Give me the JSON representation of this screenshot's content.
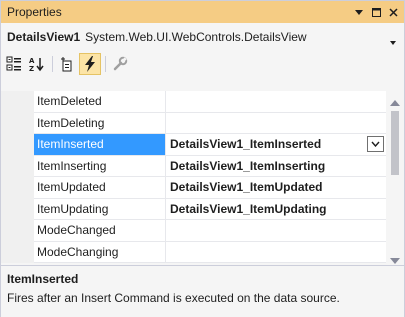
{
  "window": {
    "title": "Properties"
  },
  "object_selector": {
    "name": "DetailsView1",
    "type": "System.Web.UI.WebControls.DetailsView"
  },
  "toolbar": {
    "buttons": [
      {
        "icon": "categorized-icon",
        "active": false
      },
      {
        "icon": "alphabetical-icon",
        "active": false
      },
      {
        "icon": "properties-icon",
        "active": false
      },
      {
        "icon": "events-lightning-icon",
        "active": true
      },
      {
        "icon": "property-pages-wrench-icon",
        "active": false
      }
    ]
  },
  "events": {
    "rows": [
      {
        "name": "ItemDeleted",
        "value": ""
      },
      {
        "name": "ItemDeleting",
        "value": ""
      },
      {
        "name": "ItemInserted",
        "value": "DetailsView1_ItemInserted"
      },
      {
        "name": "ItemInserting",
        "value": "DetailsView1_ItemInserting"
      },
      {
        "name": "ItemUpdated",
        "value": "DetailsView1_ItemUpdated"
      },
      {
        "name": "ItemUpdating",
        "value": "DetailsView1_ItemUpdating"
      },
      {
        "name": "ModeChanged",
        "value": ""
      },
      {
        "name": "ModeChanging",
        "value": ""
      }
    ],
    "selected": "ItemInserted"
  },
  "description": {
    "title": "ItemInserted",
    "text": "Fires after an Insert Command is executed on the data source."
  },
  "colors": {
    "title_bar": "#f5cc84",
    "selection": "#3399ff",
    "active_button": "#fce4a6"
  }
}
